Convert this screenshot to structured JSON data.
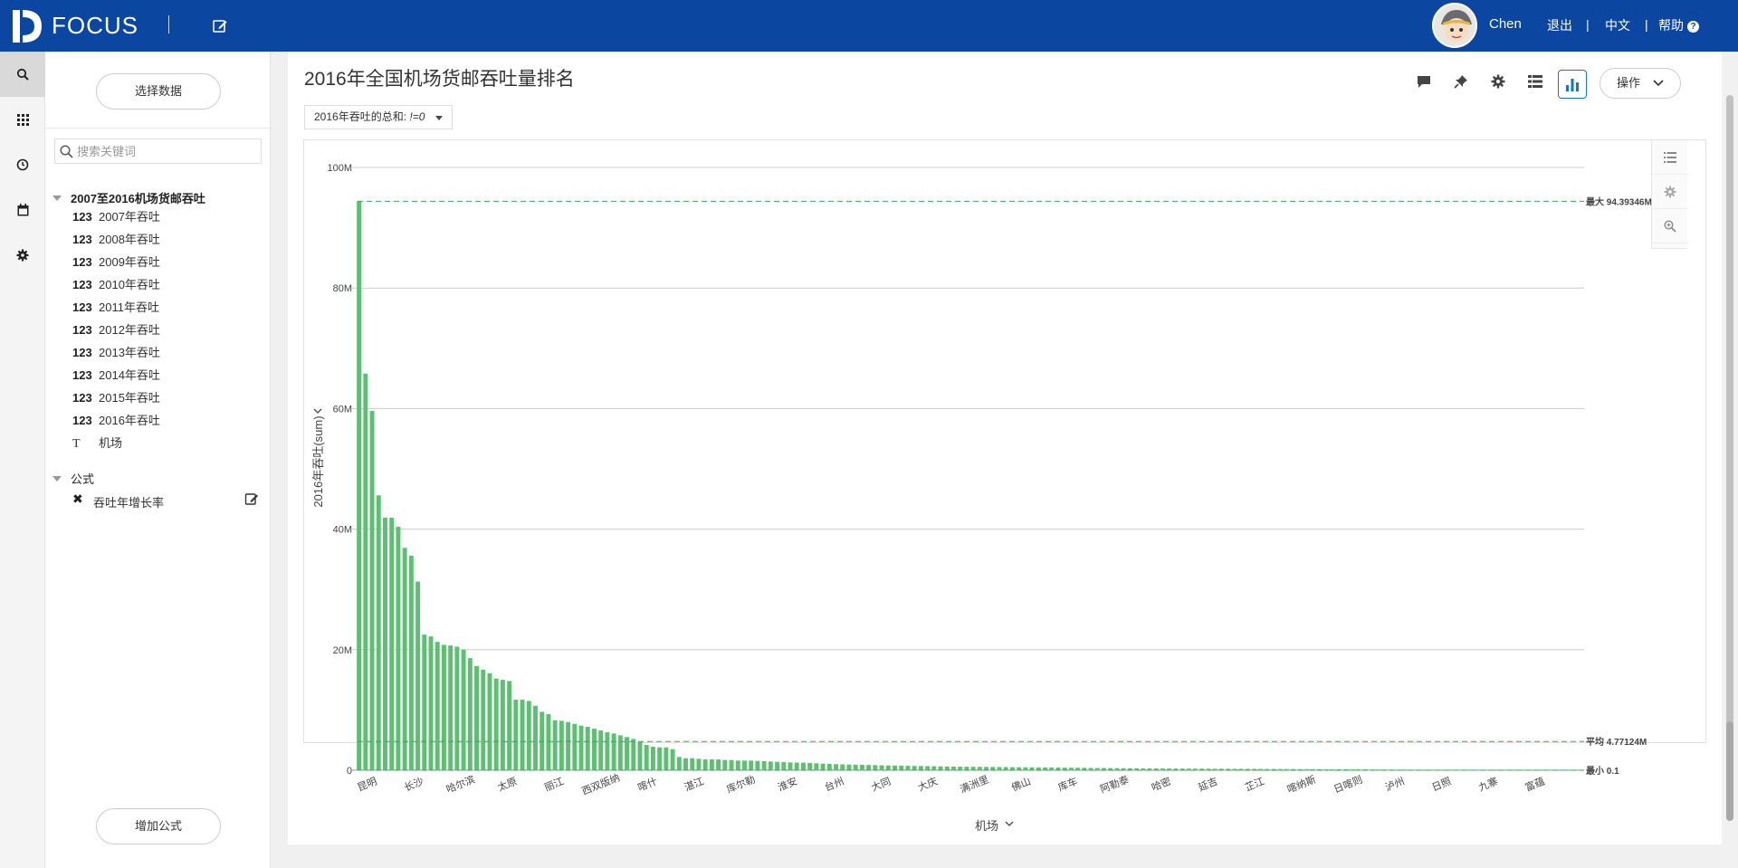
{
  "topbar": {
    "brand": "FOCUS",
    "user_name": "Chen",
    "logout": "退出",
    "language": "中文",
    "help": "帮助",
    "divider": "|",
    "help_icon": "?",
    "accent_color": "#0b47a1"
  },
  "rail": {
    "items": [
      "search-icon",
      "apps-grid-icon",
      "history-clock-icon",
      "calendar-icon",
      "settings-gear-icon"
    ]
  },
  "left_panel": {
    "select_data_button": "选择数据",
    "search_placeholder": "搜索关键词",
    "dataset_name": "2007至2016机场货邮吞吐",
    "fields": [
      {
        "type": "123",
        "label": "2007年吞吐"
      },
      {
        "type": "123",
        "label": "2008年吞吐"
      },
      {
        "type": "123",
        "label": "2009年吞吐"
      },
      {
        "type": "123",
        "label": "2010年吞吐"
      },
      {
        "type": "123",
        "label": "2011年吞吐"
      },
      {
        "type": "123",
        "label": "2012年吞吐"
      },
      {
        "type": "123",
        "label": "2013年吞吐"
      },
      {
        "type": "123",
        "label": "2014年吞吐"
      },
      {
        "type": "123",
        "label": "2015年吞吐"
      },
      {
        "type": "123",
        "label": "2016年吞吐"
      },
      {
        "type": "T",
        "label": "机场"
      }
    ],
    "formula_header": "公式",
    "formulas": [
      {
        "label": "吞吐年增长率"
      }
    ],
    "add_formula_button": "增加公式"
  },
  "main": {
    "title": "2016年全国机场货邮吞吐量排名",
    "filter_chip": "2016年吞吐的总和: != 0",
    "filter_chip_prefix": "2016年吞吐的总和:",
    "filter_chip_value": "!=0",
    "ops_button": "操作",
    "toolbar_icons": [
      "comment-icon",
      "pin-icon",
      "settings-gear-icon",
      "table-view-icon",
      "bar-chart-icon"
    ],
    "side_tools": [
      "list-icon",
      "settings-gear-icon",
      "zoom-in-icon"
    ]
  },
  "chart_data": {
    "type": "bar",
    "title": "",
    "xlabel": "机场",
    "ylabel": "2016年吞吐(sum)",
    "ylim": [
      0,
      100000000
    ],
    "y_ticks": [
      "0",
      "20M",
      "40M",
      "60M",
      "80M",
      "100M"
    ],
    "y_tick_values": [
      0,
      20000000,
      40000000,
      60000000,
      80000000,
      100000000
    ],
    "grid": true,
    "bar_color": "#5cbf72",
    "reference_line_color": "#3aa55a",
    "x_tick_labels": [
      "昆明",
      "长沙",
      "哈尔滨",
      "太原",
      "丽江",
      "西双版纳",
      "喀什",
      "湛江",
      "库尔勒",
      "淮安",
      "台州",
      "大同",
      "大庆",
      "满洲里",
      "佛山",
      "库车",
      "阿勒泰",
      "哈密",
      "延吉",
      "芷江",
      "喀纳斯",
      "日喀则",
      "泸州",
      "日照",
      "九寨",
      "富蕴"
    ],
    "reference_lines": [
      {
        "label": "最大 94.39346M",
        "value": 94393460
      },
      {
        "label": "平均 4.77124M",
        "value": 4771240
      },
      {
        "label": "最小 0.1",
        "value": 0.1
      }
    ],
    "values": [
      94393460,
      65800000,
      59600000,
      45600000,
      41900000,
      41900000,
      40400000,
      36900000,
      35600000,
      31300000,
      22500000,
      22200000,
      21300000,
      20800000,
      20700000,
      20500000,
      20000000,
      18600000,
      17300000,
      16700000,
      16100000,
      15200000,
      15000000,
      14800000,
      11700000,
      11700000,
      11500000,
      10700000,
      9700000,
      9300000,
      8300000,
      8200000,
      8000000,
      7700000,
      7400000,
      7200000,
      6900000,
      6600000,
      6300000,
      6100000,
      5800000,
      5500000,
      5200000,
      4700000,
      4200000,
      3900000,
      3800000,
      3800000,
      3500000,
      2200000,
      2000000,
      2000000,
      1900000,
      1800000,
      1800000,
      1800000,
      1700000,
      1700000,
      1600000,
      1600000,
      1600000,
      1550000,
      1500000,
      1450000,
      1400000,
      1350000,
      1300000,
      1280000,
      1250000,
      1200000,
      1150000,
      1100000,
      1050000,
      1000000,
      980000,
      950000,
      920000,
      900000,
      880000,
      850000,
      820000,
      800000,
      780000,
      760000,
      740000,
      720000,
      700000,
      680000,
      660000,
      640000,
      620000,
      600000,
      590000,
      580000,
      570000,
      560000,
      550000,
      540000,
      530000,
      520000,
      510000,
      500000,
      490000,
      480000,
      470000,
      460000,
      450000,
      440000,
      430000,
      420000,
      410000,
      400000,
      390000,
      380000,
      370000,
      360000,
      350000,
      340000,
      330000,
      320000,
      310000,
      300000,
      295000,
      290000,
      285000,
      280000,
      275000,
      270000,
      265000,
      260000,
      255000,
      250000,
      245000,
      240000,
      235000,
      230000,
      225000,
      220000,
      215000,
      210000,
      205000,
      200000,
      195000,
      190000,
      185000,
      180000,
      175000,
      170000,
      165000,
      160000,
      155000,
      150000,
      145000,
      140000,
      135000,
      130000,
      125000,
      120000,
      115000,
      110000,
      105000,
      100000,
      96000,
      92000,
      88000,
      84000,
      80000,
      76000,
      72000,
      68000,
      64000,
      60000,
      56000,
      52000,
      48000,
      44000,
      40000,
      36000,
      32000,
      28000,
      24000,
      20000,
      16000,
      12000,
      8000,
      5000,
      2000,
      0.1
    ]
  }
}
